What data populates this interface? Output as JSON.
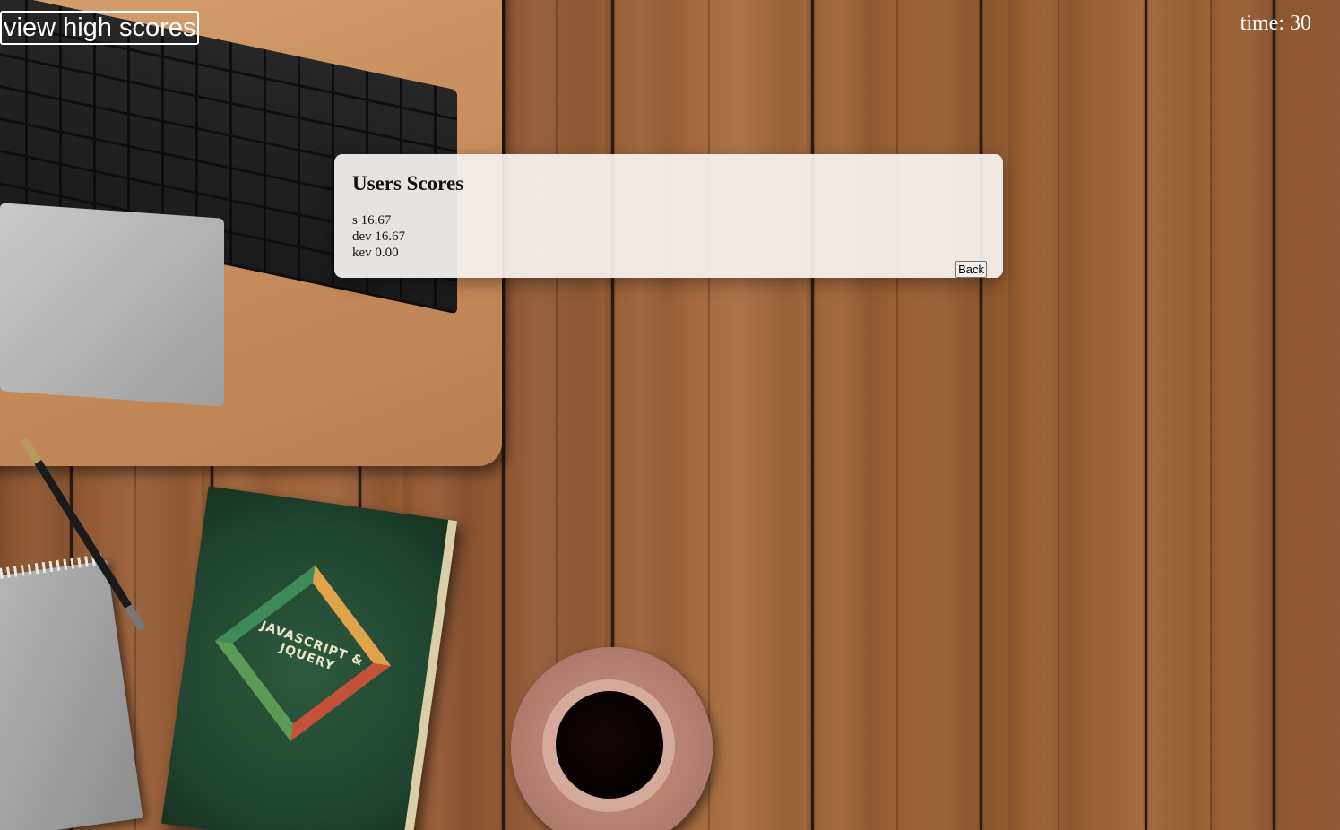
{
  "header": {
    "high_scores_label": "view high scores",
    "timer_label": "time:",
    "timer_value": "30"
  },
  "modal": {
    "title": "Users Scores",
    "scores": [
      {
        "name": "s",
        "score": "16.67"
      },
      {
        "name": "dev",
        "score": "16.67"
      },
      {
        "name": "kev",
        "score": "0.00"
      }
    ],
    "back_label": "Back"
  },
  "background": {
    "book_title": "JAVASCRIPT & JQUERY",
    "icons": [
      "laptop-image",
      "notebook-image",
      "pen-image",
      "book-image",
      "coffee-cup-image"
    ]
  },
  "colors": {
    "wood": "#9c6238",
    "overlay_text": "#ffffff",
    "modal_bg": "#f5f2f0"
  }
}
